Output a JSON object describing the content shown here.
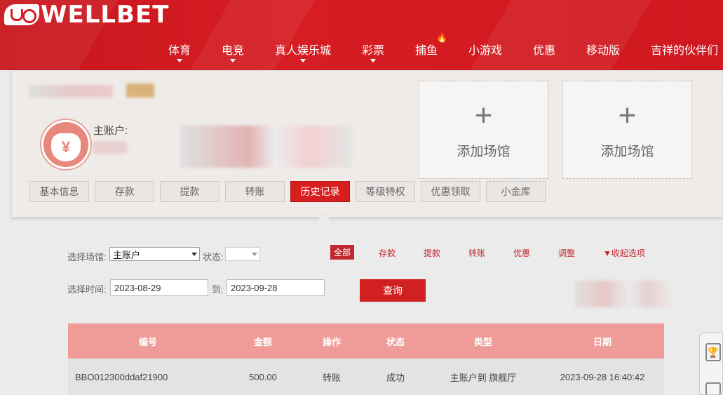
{
  "brand": {
    "logo_text": "WELLBET"
  },
  "nav": [
    {
      "label": "体育",
      "caret": true
    },
    {
      "label": "电竞",
      "caret": true
    },
    {
      "label": "真人娱乐城",
      "caret": true
    },
    {
      "label": "彩票",
      "caret": true
    },
    {
      "label": "捕鱼",
      "caret": false
    },
    {
      "label": "小游戏",
      "caret": false
    },
    {
      "label": "优惠",
      "caret": false
    },
    {
      "label": "移动版",
      "caret": false
    },
    {
      "label": "吉祥的伙伴们",
      "caret": false
    }
  ],
  "account": {
    "main_account_label": "主账户:",
    "add_venue_label": "添加场馆",
    "currency_symbol": "¥"
  },
  "tabs": [
    "基本信息",
    "存款",
    "提款",
    "转账",
    "历史记录",
    "等级特权",
    "优惠领取",
    "小金库"
  ],
  "active_tab": "历史记录",
  "filters": {
    "venue_label": "选择场馆:",
    "venue_value": "主账户",
    "status_label": "状态:",
    "status_value": "",
    "time_label": "选择时间:",
    "date_from": "2023-08-29",
    "to_label": "到:",
    "date_to": "2023-09-28",
    "query_label": "查询",
    "types": [
      "全部",
      "存款",
      "提款",
      "转账",
      "优惠",
      "调整"
    ],
    "active_type": "全部",
    "collapse_label": "▼收起选项"
  },
  "table": {
    "headers": [
      "编号",
      "金额",
      "操作",
      "状态",
      "类型",
      "日期"
    ],
    "rows": [
      [
        "BBO012300ddaf21900",
        "500.00",
        "转账",
        "成功",
        "主账户到 旗舰厅",
        "2023-09-28 16:40:42"
      ]
    ]
  },
  "colors": {
    "brand_red": "#d61d23",
    "table_header": "#ef9b98",
    "active_tab": "#d71f1f"
  }
}
